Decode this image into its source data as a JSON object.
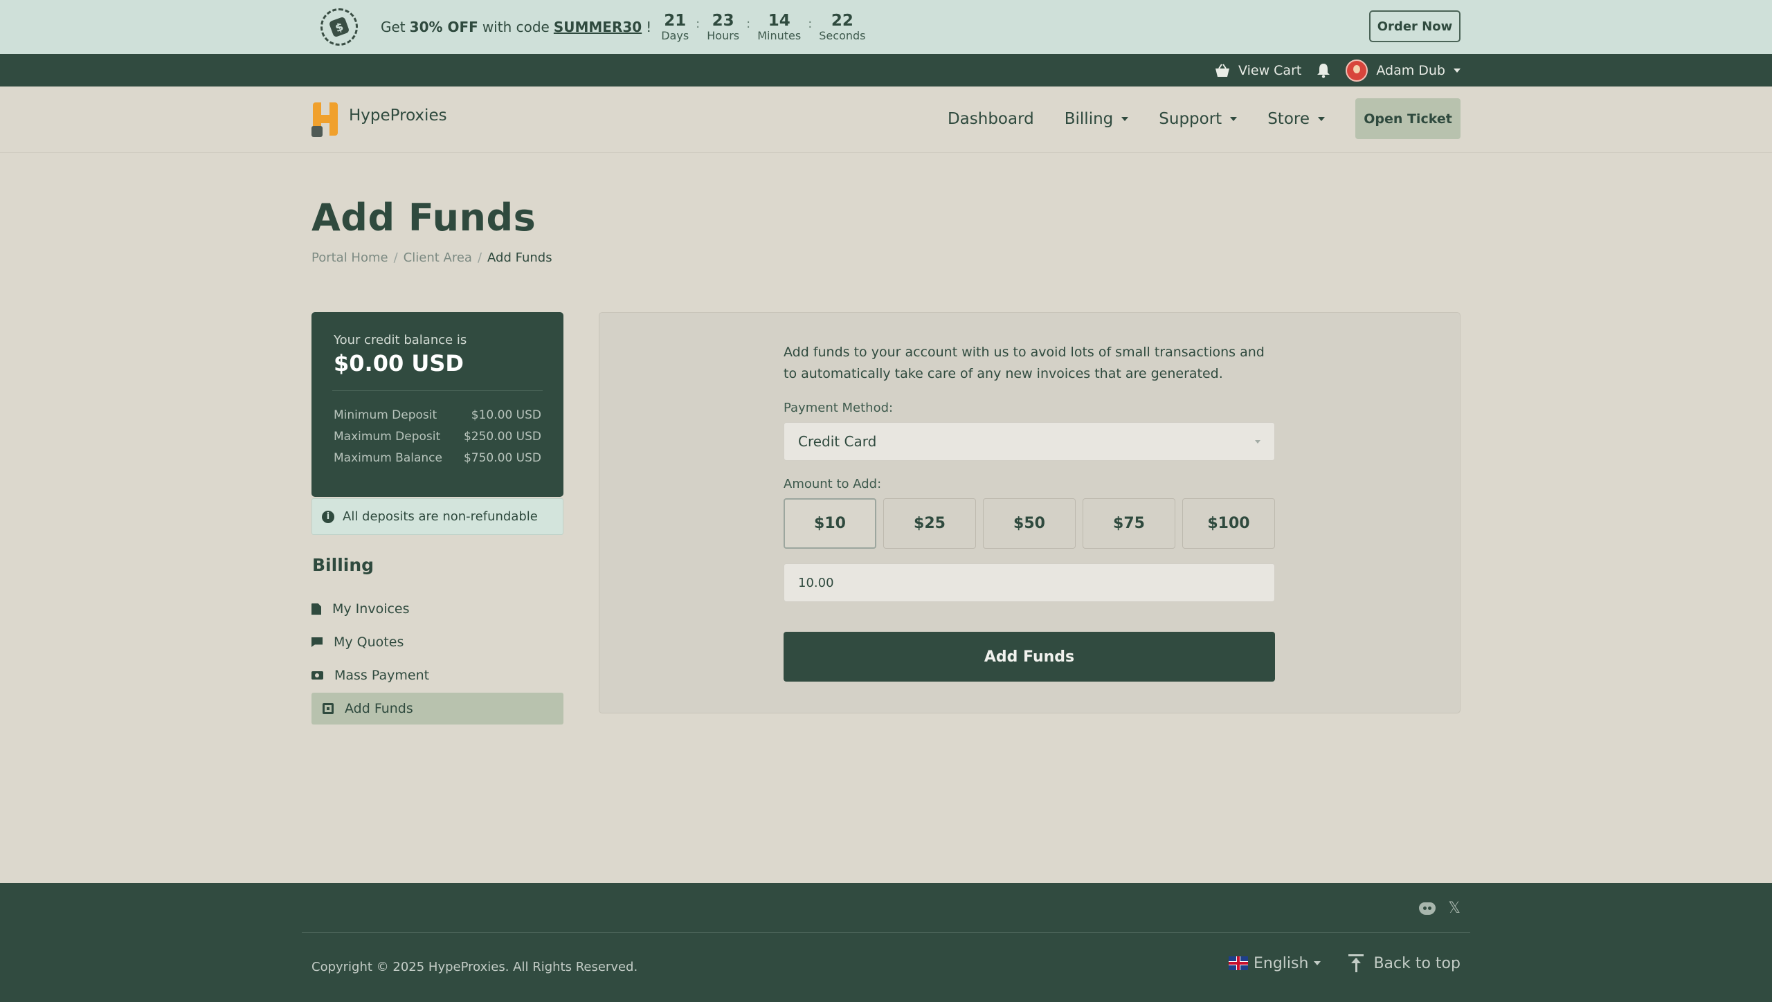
{
  "promo": {
    "text_prefix": "Get",
    "discount": "30% OFF",
    "text_mid": "with code",
    "code": "SUMMER30",
    "text_suffix": "!",
    "countdown": [
      {
        "value": "21",
        "label": "Days"
      },
      {
        "value": "23",
        "label": "Hours"
      },
      {
        "value": "14",
        "label": "Minutes"
      },
      {
        "value": "22",
        "label": "Seconds"
      }
    ],
    "order_label": "Order Now"
  },
  "userbar": {
    "cart_label": "View Cart",
    "user_name": "Adam Dub"
  },
  "nav": {
    "brand": "HypeProxies",
    "items": [
      {
        "label": "Dashboard",
        "dropdown": false
      },
      {
        "label": "Billing",
        "dropdown": true
      },
      {
        "label": "Support",
        "dropdown": true
      },
      {
        "label": "Store",
        "dropdown": true
      }
    ],
    "cta": "Open Ticket"
  },
  "page": {
    "title": "Add Funds",
    "breadcrumb": [
      "Portal Home",
      "Client Area",
      "Add Funds"
    ]
  },
  "balance": {
    "label": "Your credit balance is",
    "value": "$0.00 USD",
    "rows": [
      {
        "label": "Minimum Deposit",
        "value": "$10.00 USD"
      },
      {
        "label": "Maximum Deposit",
        "value": "$250.00 USD"
      },
      {
        "label": "Maximum Balance",
        "value": "$750.00 USD"
      }
    ],
    "notice": "All deposits are non-refundable"
  },
  "sidebar": {
    "title": "Billing",
    "items": [
      {
        "label": "My Invoices",
        "icon": "invoice-icon"
      },
      {
        "label": "My Quotes",
        "icon": "quote-icon"
      },
      {
        "label": "Mass Payment",
        "icon": "money-icon"
      },
      {
        "label": "Add Funds",
        "icon": "wallet-icon"
      }
    ]
  },
  "form": {
    "intro": "Add funds to your account with us to avoid lots of small transactions and to automatically take care of any new invoices that are generated.",
    "payment_label": "Payment Method:",
    "payment_value": "Credit Card",
    "amount_label": "Amount to Add:",
    "amounts": [
      "$10",
      "$25",
      "$50",
      "$75",
      "$100"
    ],
    "amount_value": "10.00",
    "submit": "Add Funds"
  },
  "footer": {
    "copyright": "Copyright © 2025 HypeProxies. All Rights Reserved.",
    "language": "English",
    "back_to_top": "Back to top"
  },
  "colors": {
    "dark_green": "#314b40",
    "promo_bg": "#cfe0d9",
    "page_bg": "#dcd8cd",
    "accent_sage": "#b8c2ae"
  }
}
